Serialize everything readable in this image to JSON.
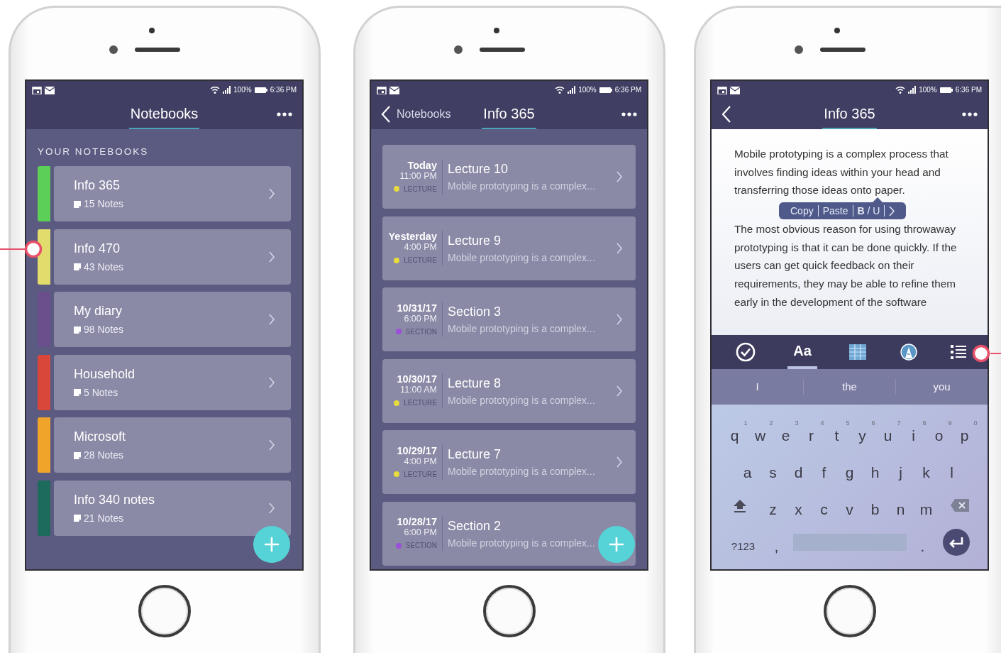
{
  "screens": [
    {
      "kind": "notebooks",
      "status_bar": {
        "battery": "100%",
        "time": "6:36 PM"
      },
      "header": {
        "back": false,
        "title": "Notebooks"
      },
      "section_label": "YOUR NOTEBOOKS",
      "notebooks": [
        {
          "name": "Info 365",
          "count": "15 Notes",
          "color": "#5ccf57"
        },
        {
          "name": "Info 470",
          "count": "43 Notes",
          "color": "#e2dc6c"
        },
        {
          "name": "My diary",
          "count": "98 Notes",
          "color": "#6a4f8c"
        },
        {
          "name": "Household",
          "count": "5 Notes",
          "color": "#d9473a"
        },
        {
          "name": "Microsoft",
          "count": "28 Notes",
          "color": "#f0a52a"
        },
        {
          "name": "Info 340 notes",
          "count": "21 Notes",
          "color": "#1d6b5c"
        }
      ]
    },
    {
      "kind": "notes",
      "status_bar": {
        "battery": "100%",
        "time": "6:36 PM"
      },
      "header": {
        "back": true,
        "back_label": "Notebooks",
        "title": "Info 365"
      },
      "notes": [
        {
          "date": "Today",
          "time": "11:00 PM",
          "type": "LECTURE",
          "color": "#e6dc3c",
          "title": "Lecture 10",
          "preview": "Mobile prototyping is a complex..."
        },
        {
          "date": "Yesterday",
          "time": "4:00 PM",
          "type": "LECTURE",
          "color": "#e6dc3c",
          "title": "Lecture 9",
          "preview": "Mobile prototyping is a complex..."
        },
        {
          "date": "10/31/17",
          "time": "6:00 PM",
          "type": "SECTION",
          "color": "#9b4fd8",
          "title": "Section 3",
          "preview": "Mobile prototyping is a complex..."
        },
        {
          "date": "10/30/17",
          "time": "11:00 AM",
          "type": "LECTURE",
          "color": "#e6dc3c",
          "title": "Lecture 8",
          "preview": "Mobile prototyping is a complex..."
        },
        {
          "date": "10/29/17",
          "time": "4:00 PM",
          "type": "LECTURE",
          "color": "#e6dc3c",
          "title": "Lecture 7",
          "preview": "Mobile prototyping is a complex..."
        },
        {
          "date": "10/28/17",
          "time": "6:00 PM",
          "type": "SECTION",
          "color": "#9b4fd8",
          "title": "Section 2",
          "preview": "Mobile prototyping is a complex...",
          "chevron_hidden": true
        }
      ]
    },
    {
      "kind": "editor",
      "status_bar": {
        "battery": "100%",
        "time": "6:36 PM"
      },
      "header": {
        "back": true,
        "title": "Info 365"
      },
      "paragraphs": [
        "Mobile prototyping is a complex process that involves finding ideas within your head and transferring those ideas onto paper.",
        "The most obvious reason for using throwaway prototyping is that it can be done quickly. If the users can get quick feedback on their requirements, they may be able to refine them early in the development of the software"
      ],
      "context_menu": [
        {
          "kind": "text",
          "label": "Copy"
        },
        {
          "kind": "text",
          "label": "Paste"
        },
        {
          "kind": "format",
          "label": "**B** / U"
        },
        {
          "kind": "chevron"
        }
      ],
      "toolbar": [
        {
          "kind": "checklist",
          "selected": false
        },
        {
          "kind": "text",
          "label": "Aa",
          "selected": true
        },
        {
          "kind": "table",
          "selected": false
        },
        {
          "kind": "draw",
          "selected": false
        },
        {
          "kind": "list",
          "selected": false
        }
      ],
      "suggestions": [
        "I",
        "the",
        "you"
      ],
      "keyboard": [
        [
          {
            "kind": "key",
            "label": "q",
            "hint": "1"
          },
          {
            "kind": "key",
            "label": "w",
            "hint": "2"
          },
          {
            "kind": "key",
            "label": "e",
            "hint": "3"
          },
          {
            "kind": "key",
            "label": "r",
            "hint": "4"
          },
          {
            "kind": "key",
            "label": "t",
            "hint": "5"
          },
          {
            "kind": "key",
            "label": "y",
            "hint": "6"
          },
          {
            "kind": "key",
            "label": "u",
            "hint": "7"
          },
          {
            "kind": "key",
            "label": "i",
            "hint": "8"
          },
          {
            "kind": "key",
            "label": "o",
            "hint": "9"
          },
          {
            "kind": "key",
            "label": "p",
            "hint": "0"
          }
        ],
        [
          {
            "kind": "key",
            "label": "a"
          },
          {
            "kind": "key",
            "label": "s"
          },
          {
            "kind": "key",
            "label": "d"
          },
          {
            "kind": "key",
            "label": "f"
          },
          {
            "kind": "key",
            "label": "g"
          },
          {
            "kind": "key",
            "label": "h"
          },
          {
            "kind": "key",
            "label": "j"
          },
          {
            "kind": "key",
            "label": "k"
          },
          {
            "kind": "key",
            "label": "l"
          }
        ],
        [
          {
            "kind": "shift"
          },
          {
            "kind": "key",
            "label": "z"
          },
          {
            "kind": "key",
            "label": "x"
          },
          {
            "kind": "key",
            "label": "c"
          },
          {
            "kind": "key",
            "label": "v"
          },
          {
            "kind": "key",
            "label": "b"
          },
          {
            "kind": "key",
            "label": "n"
          },
          {
            "kind": "key",
            "label": "m"
          },
          {
            "kind": "backspace"
          }
        ],
        [
          {
            "kind": "wide",
            "label": "?123"
          },
          {
            "kind": "key",
            "label": ","
          },
          {
            "kind": "space"
          },
          {
            "kind": "key",
            "label": "."
          },
          {
            "kind": "enter"
          }
        ]
      ]
    }
  ]
}
